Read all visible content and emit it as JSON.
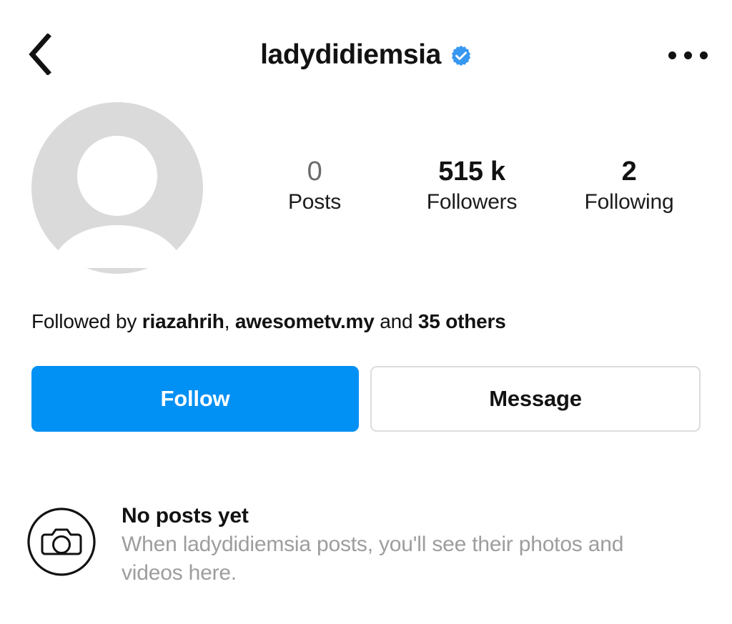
{
  "theme": {
    "background": "#ffffff",
    "accent_blue": "#0190f4",
    "text_primary": "#121212",
    "text_muted": "#9d9d9d",
    "avatar_gray": "#dadada",
    "border_gray": "#dcdcdc"
  },
  "header": {
    "back_icon": "chevron-left-icon",
    "username": "ladydidiemsia",
    "verified": true,
    "verified_icon": "verified-badge-icon",
    "more_icon": "more-options-icon"
  },
  "profile": {
    "avatar_icon": "default-avatar-person-icon",
    "avatar_has_photo": false,
    "stats": [
      {
        "key": "posts",
        "value": "0",
        "label": "Posts"
      },
      {
        "key": "followers",
        "value": "515 k",
        "label": "Followers"
      },
      {
        "key": "following",
        "value": "2",
        "label": "Following"
      }
    ],
    "followed_by": {
      "prefix": "Followed by ",
      "user_one": "riazahrih",
      "separator": ", ",
      "user_two": "awesometv.my",
      "conjunction": " and ",
      "others": "35 others"
    }
  },
  "actions": {
    "follow_label": "Follow",
    "message_label": "Message"
  },
  "empty_state": {
    "icon": "camera-circle-icon",
    "title": "No posts yet",
    "description": "When ladydidiemsia posts, you'll see their photos and videos here."
  }
}
